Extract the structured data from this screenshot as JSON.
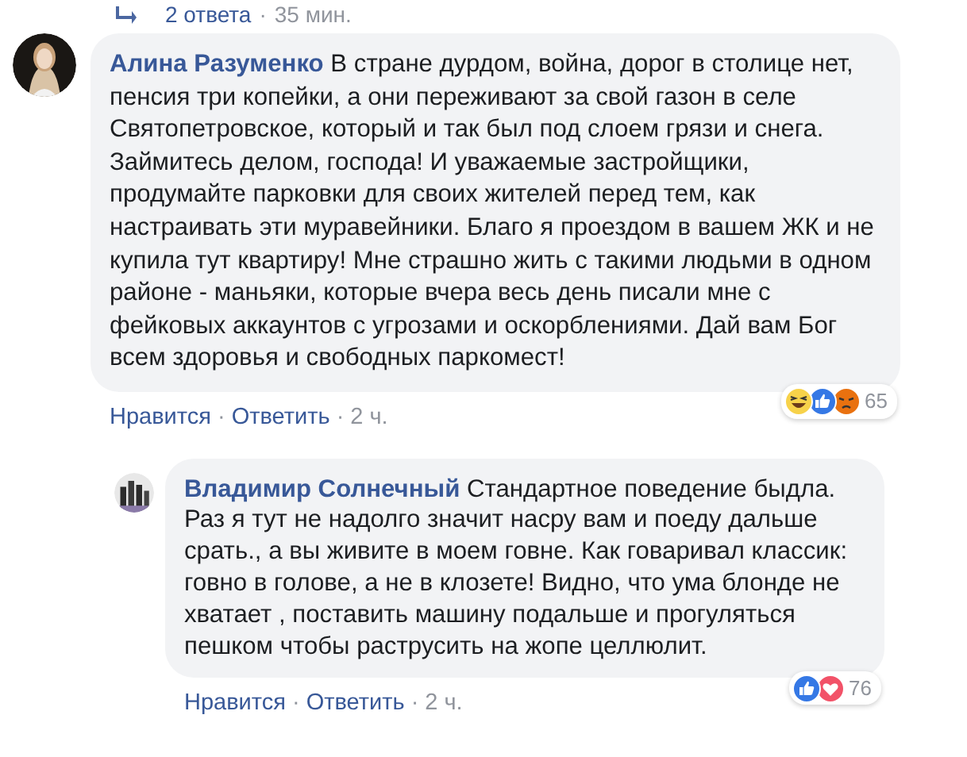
{
  "separator": "·",
  "replies_link": {
    "label": "2 ответа",
    "time": "35 мин."
  },
  "comments": [
    {
      "author": "Алина Разуменко",
      "text": "В стране дурдом, война, дорог в столице нет, пенсия три копейки, а они переживают за свой газон в селе Святопетровское, который и так был под слоем грязи и снега. Займитесь делом, господа! И уважаемые застройщики, продумайте парковки для своих жителей перед тем, как настраивать эти муравейники. Благо я проездом в вашем ЖК и не купила тут квартиру! Мне страшно жить с такими людьми в одном районе - маньяки, которые вчера весь день писали мне с фейковых аккаунтов с угрозами и оскорблениями. Дай вам Бог всем здоровья и свободных паркомест!",
      "actions": [
        "Нравится",
        "Ответить"
      ],
      "time": "2 ч.",
      "reactions": [
        {
          "kind": "haha"
        },
        {
          "kind": "like"
        },
        {
          "kind": "angry"
        }
      ],
      "reaction_count": "65",
      "children": [
        {
          "author": "Владимир Солнечный",
          "text": "Стандартное поведение быдла. Раз я тут не надолго значит насру вам и поеду дальше срать., а вы живите в моем говне. Как говаривал классик: говно в голове, а не в клозете! Видно, что ума блонде не хватает , поставить машину подальше и прогуляться пешком чтобы раструсить на жопе целлюлит.",
          "actions": [
            "Нравится",
            "Ответить"
          ],
          "time": "2 ч.",
          "reactions": [
            {
              "kind": "like"
            },
            {
              "kind": "love"
            }
          ],
          "reaction_count": "76"
        }
      ]
    }
  ]
}
